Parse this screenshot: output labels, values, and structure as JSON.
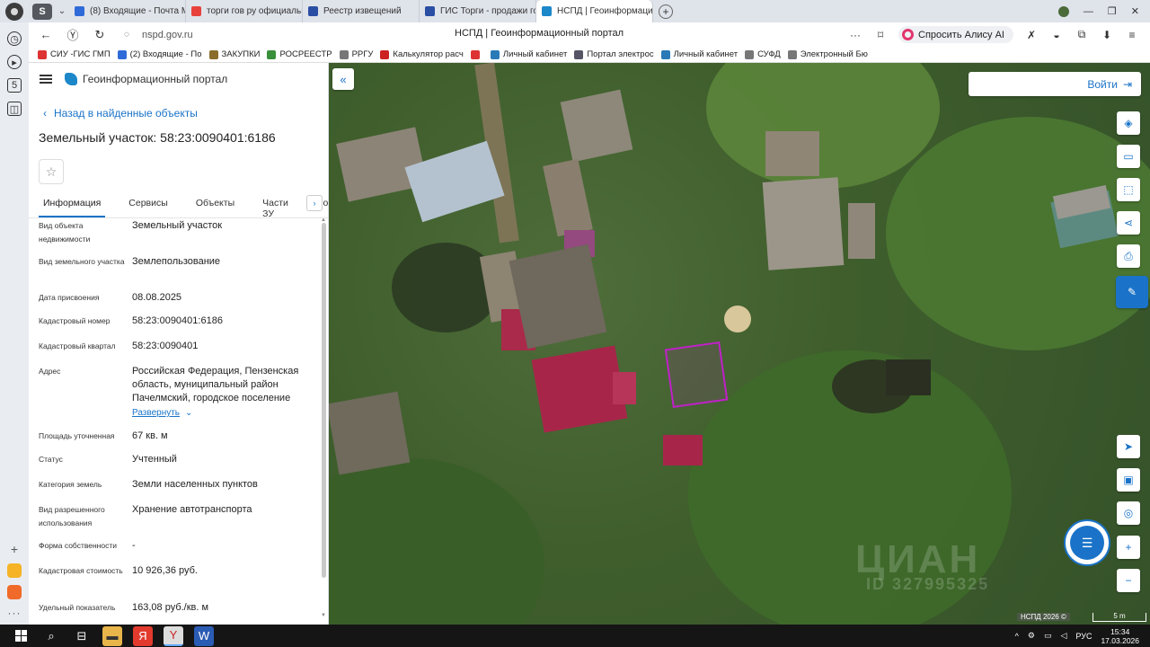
{
  "browser": {
    "tabs": [
      {
        "label": "(8) Входящие - Почта Ma",
        "color": "#2f6bd8",
        "active": false
      },
      {
        "label": "торги гов ру официальн",
        "color": "#e8413b",
        "active": false
      },
      {
        "label": "Реестр извещений",
        "color": "#2a4ea3",
        "active": false
      },
      {
        "label": "ГИС Торги - продажи гос",
        "color": "#2a4ea3",
        "active": false
      },
      {
        "label": "НСПД | Геоинформацион",
        "color": "#1c87c9",
        "active": true
      }
    ],
    "url": "nspd.gov.ru",
    "page_title": "НСПД | Геоинформационный портал",
    "alice_label": "Спросить Алису AI",
    "bookmarks": [
      {
        "label": "СИУ -ГИС ГМП",
        "color": "#d33"
      },
      {
        "label": "(2) Входящие - По",
        "color": "#2f6bd8"
      },
      {
        "label": "ЗАКУПКИ",
        "color": "#8a6d2a"
      },
      {
        "label": "РОСРЕЕСТР",
        "color": "#3a8f3a"
      },
      {
        "label": "РРГУ",
        "color": "#777"
      },
      {
        "label": "Калькулятор расч",
        "color": "#c22"
      },
      {
        "label": "",
        "color": "#d33"
      },
      {
        "label": "Личный кабинет",
        "color": "#2a7ab8"
      },
      {
        "label": "Портал электрос",
        "color": "#556"
      },
      {
        "label": "Личный кабинет",
        "color": "#2a7ab8"
      },
      {
        "label": "СУФД",
        "color": "#777"
      },
      {
        "label": "Электронный Бю",
        "color": "#777"
      }
    ]
  },
  "panel": {
    "header_title": "Геоинформационный портал",
    "back_label": "Назад в найденные объекты",
    "object_title": "Земельный участок: 58:23:0090401:6186",
    "tabs": [
      "Информация",
      "Сервисы",
      "Объекты",
      "Части ЗУ",
      "Состав"
    ],
    "properties": [
      {
        "key": "Вид объекта недвижимости",
        "value": "Земельный участок"
      },
      {
        "key": "Вид земельного участка",
        "value": "Землепользование"
      },
      {
        "key": "Дата присвоения",
        "value": "08.08.2025"
      },
      {
        "key": "Кадастровый номер",
        "value": "58:23:0090401:6186"
      },
      {
        "key": "Кадастровый квартал",
        "value": "58:23:0090401"
      },
      {
        "key": "Адрес",
        "value": "Российская Федерация, Пензенская область, муниципальный район Пачелмский, городское поселение"
      },
      {
        "key": "Площадь уточненная",
        "value": "67 кв. м"
      },
      {
        "key": "Статус",
        "value": "Учтенный"
      },
      {
        "key": "Категория земель",
        "value": "Земли населенных пунктов"
      },
      {
        "key": "Вид разрешенного использования",
        "value": "Хранение автотранспорта"
      },
      {
        "key": "Форма собственности",
        "value": "-"
      },
      {
        "key": "Кадастровая стоимость",
        "value": "10 926,36 руб."
      },
      {
        "key": "Удельный показатель",
        "value": "163,08 руб./кв. м"
      }
    ],
    "expand_label": "Развернуть"
  },
  "map": {
    "login_label": "Войти",
    "copyright": "НСПД 2026 ©",
    "scale": "5 m",
    "watermark_1": "ЦИАН",
    "watermark_2": "ID 327995325",
    "parcel_color": "#c020c8"
  },
  "taskbar": {
    "lang": "РУС",
    "time": "15:34",
    "date": "17.03.2026"
  }
}
